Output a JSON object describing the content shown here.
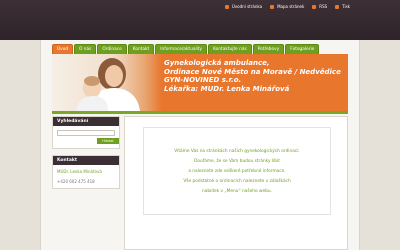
{
  "top_links": [
    {
      "label": "Úvodní stránka"
    },
    {
      "label": "Mapa stránek"
    },
    {
      "label": "RSS"
    },
    {
      "label": "Tisk"
    }
  ],
  "nav_tabs": [
    {
      "label": "Úvod",
      "active": true
    },
    {
      "label": "O nás",
      "active": false
    },
    {
      "label": "Ordinace",
      "active": false
    },
    {
      "label": "Kontakt",
      "active": false
    },
    {
      "label": "Informace/aktuality",
      "active": false
    },
    {
      "label": "Kontaktujte nás",
      "active": false
    },
    {
      "label": "Potřebovy",
      "active": false
    },
    {
      "label": "Fotogalerie",
      "active": false
    }
  ],
  "banner": {
    "line1": "Gynekologická ambulance,",
    "line2": "Ordinace Nové Město na Moravě / Nedvědice",
    "line3": "GYN-NOVINED s.r.o.",
    "line4": "Lékařka: MUDr. Lenka Minářová"
  },
  "sidebar": {
    "search_title": "Vyhledávání",
    "search_button": "Hledat",
    "contact_title": "Kontakt",
    "contact_name": "MUDr. Lenka Minářová",
    "contact_phone": "+420 602 475 418"
  },
  "content": {
    "lines": [
      "Vítáme Vás na stránkách našich gynekologických ordinací.",
      "Doufáme, že se Vám budou stránky líbit",
      "a naleznete zde veškeré potřebné informace.",
      "Vše podstatné o ordinacích naleznete v záložkách",
      "nabídek v „Menu“ našeho webu."
    ]
  },
  "colors": {
    "accent_orange": "#e8762d",
    "accent_green": "#6f9f1f",
    "dark": "#3b2f35"
  }
}
